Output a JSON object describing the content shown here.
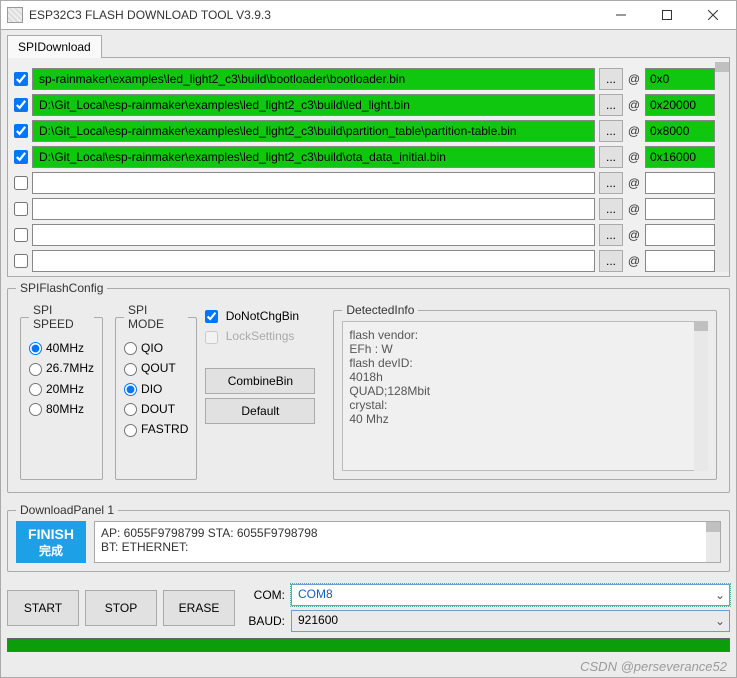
{
  "window": {
    "title": "ESP32C3 FLASH DOWNLOAD TOOL V3.9.3"
  },
  "tabs": {
    "spi_download": "SPIDownload"
  },
  "download_files": {
    "rows": [
      {
        "checked": true,
        "path": "sp-rainmaker\\examples\\led_light2_c3\\build\\bootloader\\bootloader.bin",
        "addr": "0x0",
        "valid": true
      },
      {
        "checked": true,
        "path": "D:\\Git_Local\\esp-rainmaker\\examples\\led_light2_c3\\build\\led_light.bin",
        "addr": "0x20000",
        "valid": true
      },
      {
        "checked": true,
        "path": "D:\\Git_Local\\esp-rainmaker\\examples\\led_light2_c3\\build\\partition_table\\partition-table.bin",
        "addr": "0x8000",
        "valid": true
      },
      {
        "checked": true,
        "path": "D:\\Git_Local\\esp-rainmaker\\examples\\led_light2_c3\\build\\ota_data_initial.bin",
        "addr": "0x16000",
        "valid": true
      },
      {
        "checked": false,
        "path": "",
        "addr": "",
        "valid": false
      },
      {
        "checked": false,
        "path": "",
        "addr": "",
        "valid": false
      },
      {
        "checked": false,
        "path": "",
        "addr": "",
        "valid": false
      },
      {
        "checked": false,
        "path": "",
        "addr": "",
        "valid": false
      }
    ],
    "browse_label": "...",
    "at_symbol": "@"
  },
  "spi_flash_config": {
    "legend": "SPIFlashConfig",
    "spi_speed": {
      "legend": "SPI SPEED",
      "options": [
        "40MHz",
        "26.7MHz",
        "20MHz",
        "80MHz"
      ],
      "selected": "40MHz"
    },
    "spi_mode": {
      "legend": "SPI MODE",
      "options": [
        "QIO",
        "QOUT",
        "DIO",
        "DOUT",
        "FASTRD"
      ],
      "selected": "DIO"
    },
    "options": {
      "donotchg": {
        "label": "DoNotChgBin",
        "checked": true
      },
      "locksettings": {
        "label": "LockSettings",
        "checked": false
      }
    },
    "buttons": {
      "combine": "CombineBin",
      "default": "Default"
    },
    "detected": {
      "legend": "DetectedInfo",
      "lines": [
        "flash vendor:",
        "EFh : W",
        "flash devID:",
        "4018h",
        "QUAD;128Mbit",
        "crystal:",
        "40 Mhz"
      ]
    }
  },
  "download_panel": {
    "legend": "DownloadPanel 1",
    "status_en": "FINISH",
    "status_cn": "完成",
    "log_line1": "AP: 6055F9798799  STA: 6055F9798798",
    "log_line2": "BT:   ETHERNET:"
  },
  "controls": {
    "start": "START",
    "stop": "STOP",
    "erase": "ERASE",
    "com_label": "COM:",
    "com_value": "COM8",
    "baud_label": "BAUD:",
    "baud_value": "921600"
  },
  "watermark": "CSDN @perseverance52"
}
